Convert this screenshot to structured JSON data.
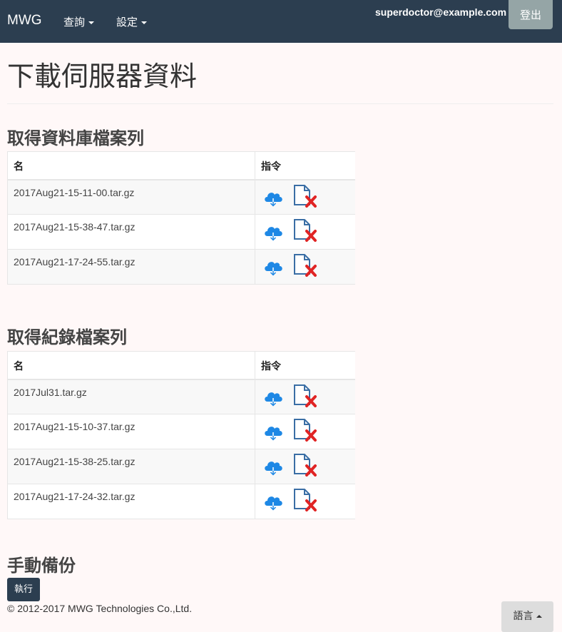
{
  "navbar": {
    "brand": "MWG",
    "menus": [
      {
        "label": "查詢"
      },
      {
        "label": "設定"
      }
    ],
    "user_email": "superdoctor@example.com",
    "logout_label": "登出"
  },
  "page": {
    "title": "下載伺服器資料"
  },
  "db_section": {
    "title": "取得資料庫檔案列",
    "columns": [
      "名",
      "指令"
    ],
    "files": [
      "2017Aug21-15-11-00.tar.gz",
      "2017Aug21-15-38-47.tar.gz",
      "2017Aug21-17-24-55.tar.gz"
    ]
  },
  "log_section": {
    "title": "取得紀錄檔案列",
    "columns": [
      "名",
      "指令"
    ],
    "files": [
      "2017Jul31.tar.gz",
      "2017Aug21-15-10-37.tar.gz",
      "2017Aug21-15-38-25.tar.gz",
      "2017Aug21-17-24-32.tar.gz"
    ]
  },
  "backup_section": {
    "title": "手動備份",
    "run_label": "執行"
  },
  "footer": {
    "copyright": "© 2012-2017 MWG Technologies Co.,Ltd."
  },
  "language_button": "語言",
  "icons": {
    "download": "cloud-download-icon",
    "delete": "file-delete-icon"
  },
  "colors": {
    "navbar": "#2c3e50",
    "download_icon": "#1e88e5",
    "delete_x": "#e02424"
  }
}
